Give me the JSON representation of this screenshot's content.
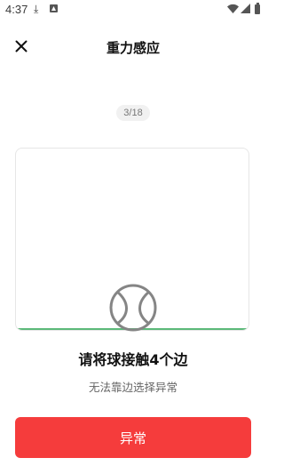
{
  "status_bar": {
    "time": "4:37",
    "icons": [
      "download-icon",
      "app-notification-icon",
      "wifi-icon",
      "signal-icon",
      "battery-icon"
    ]
  },
  "header": {
    "title": "重力感应",
    "close_icon": "close-icon"
  },
  "progress": {
    "counter": "3/18",
    "current": 3,
    "total": 18
  },
  "sensor": {
    "ball_icon": "tennis-ball-icon",
    "touched_edge": "bottom",
    "edge_color": "#5cb979"
  },
  "instruction": {
    "main": "请将球接触4个边",
    "sub": "无法靠边选择异常"
  },
  "action": {
    "abnormal_label": "异常",
    "accent_color": "#f53c3c"
  }
}
